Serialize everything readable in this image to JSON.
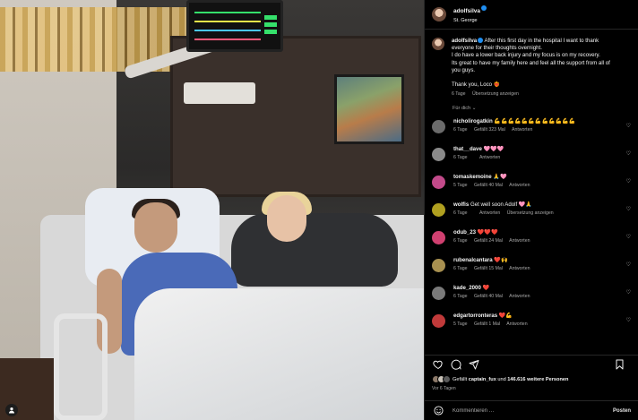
{
  "post": {
    "username": "adolfsilva",
    "location": "St. George",
    "caption_lines": [
      "After this first day in the hospital I want to thank",
      "everyone for their thoughts overnight.",
      "I do have a lower back injury and my focus is on my recovery.",
      "Its great to have my family here and feel all the support from all of",
      "you guys.",
      "",
      "Thank you, Loco ❤️‍🔥"
    ],
    "caption_age": "6 Tage",
    "caption_translate": "Übersetzung anzeigen",
    "for_you_label": "Für dich ⌄"
  },
  "comments": [
    {
      "user": "nicholirogatkin",
      "text": "💪💪💪💪💪💪💪💪💪💪💪💪",
      "age": "6 Tage",
      "likes": "Gefällt 323 Mal",
      "reply": "Antworten",
      "extra": "",
      "color": "#6b6b6b"
    },
    {
      "user": "that__dave",
      "text": "🩷🩷🩷",
      "age": "6 Tage",
      "likes": "",
      "reply": "Antworten",
      "extra": "",
      "color": "#8a8a8a"
    },
    {
      "user": "tomaskemoine",
      "text": "🙏🩷",
      "age": "5 Tage",
      "likes": "Gefällt 40 Mal",
      "reply": "Antworten",
      "extra": "",
      "color": "#c24a8a"
    },
    {
      "user": "wolfis",
      "text": "Get well soon Adolf 🩷🙏",
      "age": "6 Tage",
      "likes": "",
      "reply": "Antworten",
      "extra": "Übersetzung anzeigen",
      "color": "#b0a020"
    },
    {
      "user": "odub_23",
      "text": "❤️❤️❤️",
      "age": "6 Tage",
      "likes": "Gefällt 24 Mal",
      "reply": "Antworten",
      "extra": "",
      "color": "#d04070"
    },
    {
      "user": "rubenalcantara",
      "text": "❤️🙌",
      "age": "6 Tage",
      "likes": "Gefällt 15 Mal",
      "reply": "Antworten",
      "extra": "",
      "color": "#a89050"
    },
    {
      "user": "kade_2000",
      "text": "❤️",
      "age": "6 Tage",
      "likes": "Gefällt 40 Mal",
      "reply": "Antworten",
      "extra": "",
      "color": "#7a7a7a"
    },
    {
      "user": "edgartorronteras",
      "text": "❤️💪",
      "age": "5 Tage",
      "likes": "Gefällt 1 Mal",
      "reply": "Antworten",
      "extra": "",
      "color": "#c03a3a"
    }
  ],
  "likes": {
    "prefix": "Gefällt",
    "liked_by": "captain_fux",
    "and": "und",
    "others": "146.616 weitere Personen"
  },
  "time_ago": "Vor 6 Tagen",
  "comment_box": {
    "placeholder": "Kommentieren …",
    "post_label": "Posten"
  },
  "colors": {
    "verified": "#1f8ef1",
    "secondary_text": "#a8a8a8",
    "background": "#000000"
  }
}
